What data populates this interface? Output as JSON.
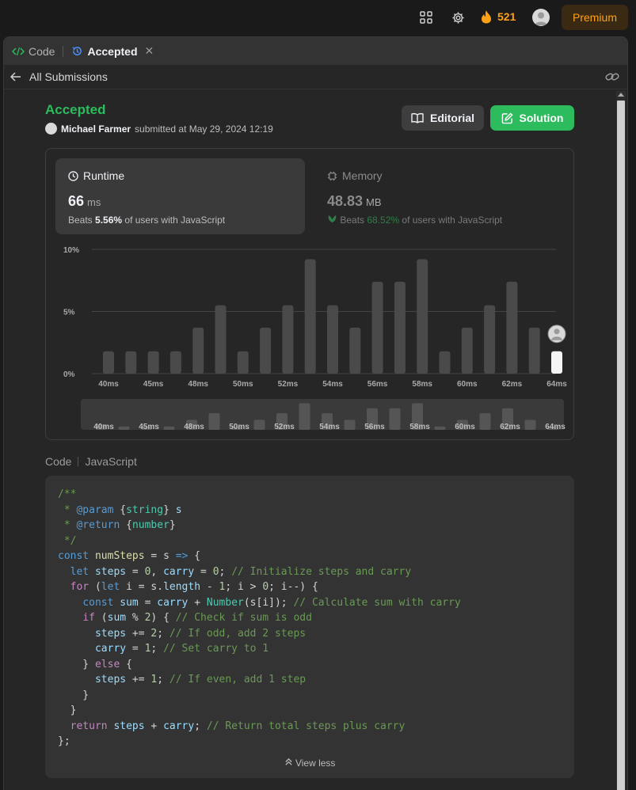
{
  "topnav": {
    "streak_count": "521",
    "premium_label": "Premium"
  },
  "tabs": {
    "code_label": "Code",
    "accepted_label": "Accepted"
  },
  "subbar": {
    "back_label": "All Submissions"
  },
  "submission": {
    "status": "Accepted",
    "author": "Michael Farmer",
    "submitted_text": "submitted at May 29, 2024 12:19"
  },
  "buttons": {
    "editorial": "Editorial",
    "solution": "Solution"
  },
  "runtime": {
    "title": "Runtime",
    "value": "66",
    "unit": "ms",
    "beats_prefix": "Beats",
    "beats_pct": "5.56%",
    "beats_suffix": "of users with JavaScript"
  },
  "memory": {
    "title": "Memory",
    "value": "48.83",
    "unit": "MB",
    "beats_prefix": "Beats",
    "beats_pct": "68.52%",
    "beats_suffix": "of users with JavaScript"
  },
  "chart_data": {
    "type": "bar",
    "yticks": [
      "10%",
      "5%",
      "0%"
    ],
    "ylim": [
      0,
      10
    ],
    "xticks": [
      "40ms",
      "45ms",
      "48ms",
      "50ms",
      "52ms",
      "54ms",
      "56ms",
      "58ms",
      "60ms",
      "62ms",
      "64ms"
    ],
    "values": [
      1.8,
      1.8,
      1.8,
      1.8,
      3.7,
      5.5,
      1.8,
      3.7,
      5.5,
      9.2,
      5.5,
      3.7,
      7.4,
      7.4,
      9.2,
      1.8,
      3.7,
      5.5,
      7.4,
      3.7,
      1.8
    ],
    "highlight_index": 20,
    "overview_values": [
      1.0,
      0.6,
      0.6,
      0.6,
      1.8,
      3.0,
      0.6,
      1.8,
      3.0,
      4.8,
      3.0,
      1.8,
      3.9,
      3.9,
      4.8,
      0.6,
      1.8,
      3.0,
      3.9,
      1.8,
      0.6
    ]
  },
  "code_section": {
    "label": "Code",
    "language": "JavaScript"
  },
  "code_lines": [
    "/**",
    " * @param {string} s",
    " * @return {number}",
    " */",
    "const numSteps = s => {",
    "  let steps = 0, carry = 0; // Initialize steps and carry",
    "  for (let i = s.length - 1; i > 0; i--) {",
    "    const sum = carry + Number(s[i]); // Calculate sum with carry",
    "    if (sum % 2) { // Check if sum is odd",
    "      steps += 2; // If odd, add 2 steps",
    "      carry = 1; // Set carry to 1",
    "    } else {",
    "      steps += 1; // If even, add 1 step",
    "    }",
    "  }",
    "  return steps + carry; // Return total steps plus carry",
    "};"
  ],
  "view_less": "View less"
}
